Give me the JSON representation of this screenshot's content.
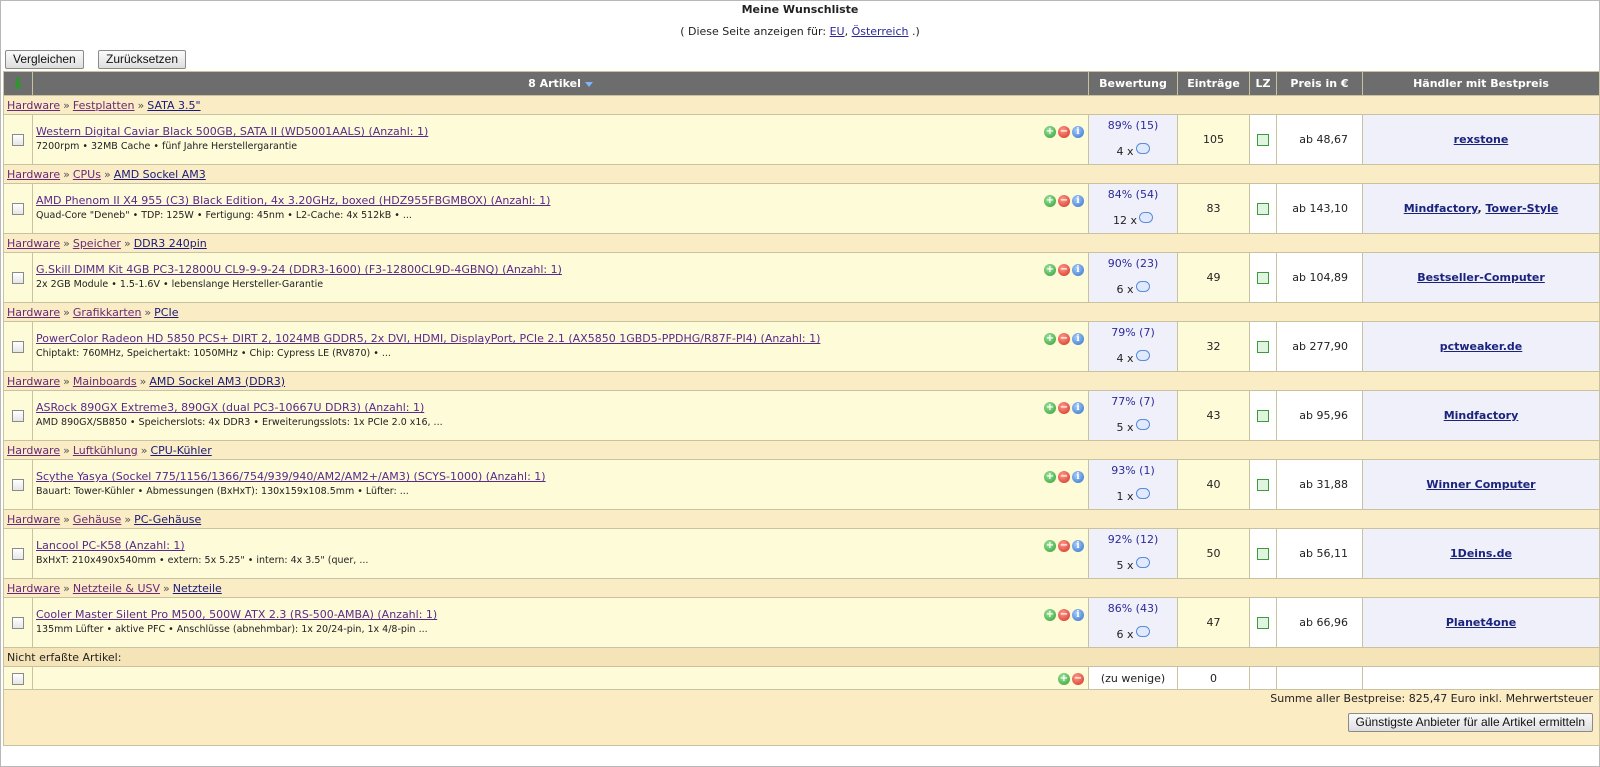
{
  "page": {
    "title": "Meine Wunschliste",
    "show_for_prefix": "( Diese Seite anzeigen für:",
    "show_for_eu": "EU",
    "show_for_sep": ",",
    "show_for_at": "Österreich",
    "show_for_suffix": ".)"
  },
  "toolbar": {
    "compare_label": "Vergleichen",
    "reset_label": "Zurücksetzen"
  },
  "table": {
    "headers": {
      "sort_icon": "green-down-arrow-icon",
      "articles": "8 Artikel",
      "rating": "Bewertung",
      "entries": "Einträge",
      "lz": "LZ",
      "price": "Preis in €",
      "seller": "Händler mit Bestpreis"
    },
    "sections": [
      {
        "crumb": [
          "Hardware",
          "Festplatten",
          "SATA 3.5\""
        ],
        "item": {
          "name": "Western Digital Caviar Black 500GB, SATA II (WD5001AALS) (Anzahl: 1)",
          "details": "7200rpm • 32MB Cache • fünf Jahre Herstellergarantie",
          "rating": "89% (15)",
          "reviews": "4 x",
          "entries": "105",
          "price": "ab 48,67",
          "sellers": [
            "rexstone"
          ]
        }
      },
      {
        "crumb": [
          "Hardware",
          "CPUs",
          "AMD Sockel AM3"
        ],
        "item": {
          "name": "AMD Phenom II X4 955 (C3) Black Edition, 4x 3.20GHz, boxed (HDZ955FBGMBOX) (Anzahl: 1)",
          "details": "Quad-Core \"Deneb\" • TDP: 125W • Fertigung: 45nm • L2-Cache: 4x 512kB • ...",
          "rating": "84% (54)",
          "reviews": "12 x",
          "entries": "83",
          "price": "ab 143,10",
          "sellers": [
            "Mindfactory",
            "Tower-Style"
          ]
        }
      },
      {
        "crumb": [
          "Hardware",
          "Speicher",
          "DDR3 240pin"
        ],
        "item": {
          "name": "G.Skill DIMM Kit 4GB PC3-12800U CL9-9-9-24 (DDR3-1600) (F3-12800CL9D-4GBNQ) (Anzahl: 1)",
          "details": "2x 2GB Module • 1.5-1.6V • lebenslange Hersteller-Garantie",
          "rating": "90% (23)",
          "reviews": "6 x",
          "entries": "49",
          "price": "ab 104,89",
          "sellers": [
            "Bestseller-Computer"
          ]
        }
      },
      {
        "crumb": [
          "Hardware",
          "Grafikkarten",
          "PCIe"
        ],
        "item": {
          "name": "PowerColor Radeon HD 5850 PCS+ DIRT 2, 1024MB GDDR5, 2x DVI, HDMI, DisplayPort, PCIe 2.1 (AX5850 1GBD5-PPDHG/R87F-PI4) (Anzahl: 1)",
          "details": "Chiptakt: 760MHz, Speichertakt: 1050MHz • Chip: Cypress LE (RV870) • ...",
          "rating": "79% (7)",
          "reviews": "4 x",
          "entries": "32",
          "price": "ab 277,90",
          "sellers": [
            "pctweaker.de"
          ]
        }
      },
      {
        "crumb": [
          "Hardware",
          "Mainboards",
          "AMD Sockel AM3 (DDR3)"
        ],
        "item": {
          "name": "ASRock 890GX Extreme3, 890GX (dual PC3-10667U DDR3) (Anzahl: 1)",
          "details": "AMD 890GX/SB850 • Speicherslots: 4x DDR3 • Erweiterungsslots: 1x PCIe 2.0 x16, ...",
          "rating": "77% (7)",
          "reviews": "5 x",
          "entries": "43",
          "price": "ab 95,96",
          "sellers": [
            "Mindfactory"
          ]
        }
      },
      {
        "crumb": [
          "Hardware",
          "Luftkühlung",
          "CPU-Kühler"
        ],
        "item": {
          "name": "Scythe Yasya (Sockel 775/1156/1366/754/939/940/AM2/AM2+/AM3) (SCYS-1000) (Anzahl: 1)",
          "details": "Bauart: Tower-Kühler • Abmessungen (BxHxT): 130x159x108.5mm • Lüfter: ...",
          "rating": "93% (1)",
          "reviews": "1 x",
          "entries": "40",
          "price": "ab 31,88",
          "sellers": [
            "Winner Computer"
          ]
        }
      },
      {
        "crumb": [
          "Hardware",
          "Gehäuse",
          "PC-Gehäuse"
        ],
        "item": {
          "name": "Lancool PC-K58 (Anzahl: 1)",
          "details": "BxHxT: 210x490x540mm • extern: 5x 5.25\" • intern: 4x 3.5\" (quer, ...",
          "rating": "92% (12)",
          "reviews": "5 x",
          "entries": "50",
          "price": "ab 56,11",
          "sellers": [
            "1Deins.de"
          ]
        }
      },
      {
        "crumb": [
          "Hardware",
          "Netzteile & USV",
          "Netzteile"
        ],
        "item": {
          "name": "Cooler Master Silent Pro M500, 500W ATX 2.3 (RS-500-AMBA) (Anzahl: 1)",
          "details": "135mm Lüfter • aktive PFC • Anschlüsse (abnehmbar): 1x 20/24-pin, 1x 4/8-pin ...",
          "rating": "86% (43)",
          "reviews": "6 x",
          "entries": "47",
          "price": "ab 66,96",
          "sellers": [
            "Planet4one"
          ]
        }
      }
    ],
    "missing": {
      "label": "Nicht erfaßte Artikel:",
      "rating": "(zu wenige)",
      "entries": "0"
    },
    "footer": {
      "sum": "Summe aller Bestpreise: 825,47 Euro inkl. Mehrwertsteuer",
      "cheapest_button": "Günstigste Anbieter für alle Artikel ermitteln"
    }
  },
  "colors": {
    "header_bg": "#6d6d6d",
    "crumb_bg": "#faecc4",
    "row_bg": "#fefbd9",
    "link": "#5a2a8a",
    "seller": "#1a237e"
  }
}
